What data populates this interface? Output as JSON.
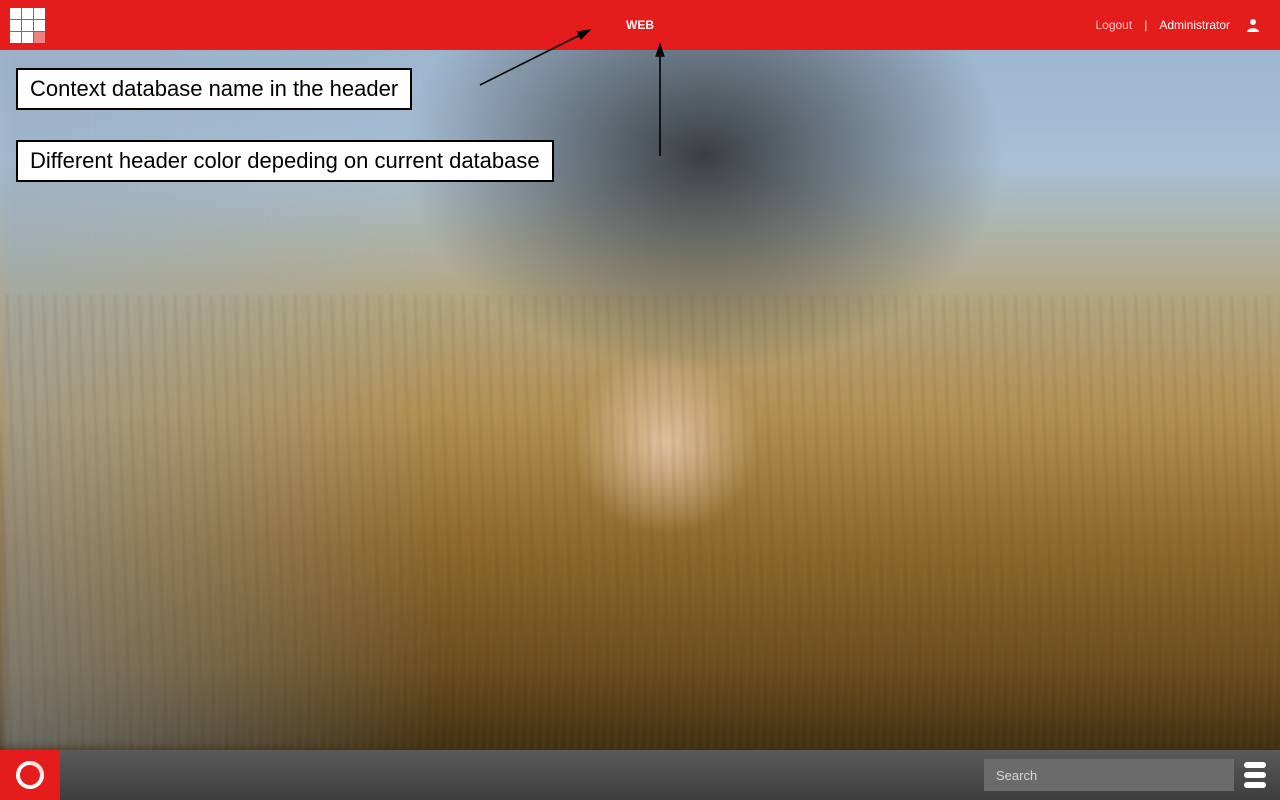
{
  "header": {
    "database_name": "WEB",
    "logout_label": "Logout",
    "separator": "|",
    "user_label": "Administrator"
  },
  "annotations": {
    "db_name_callout": "Context database name in the header",
    "header_color_callout": "Different header color depeding on current database"
  },
  "footer": {
    "search_placeholder": "Search"
  },
  "colors": {
    "header_bg": "#e51c1c"
  }
}
